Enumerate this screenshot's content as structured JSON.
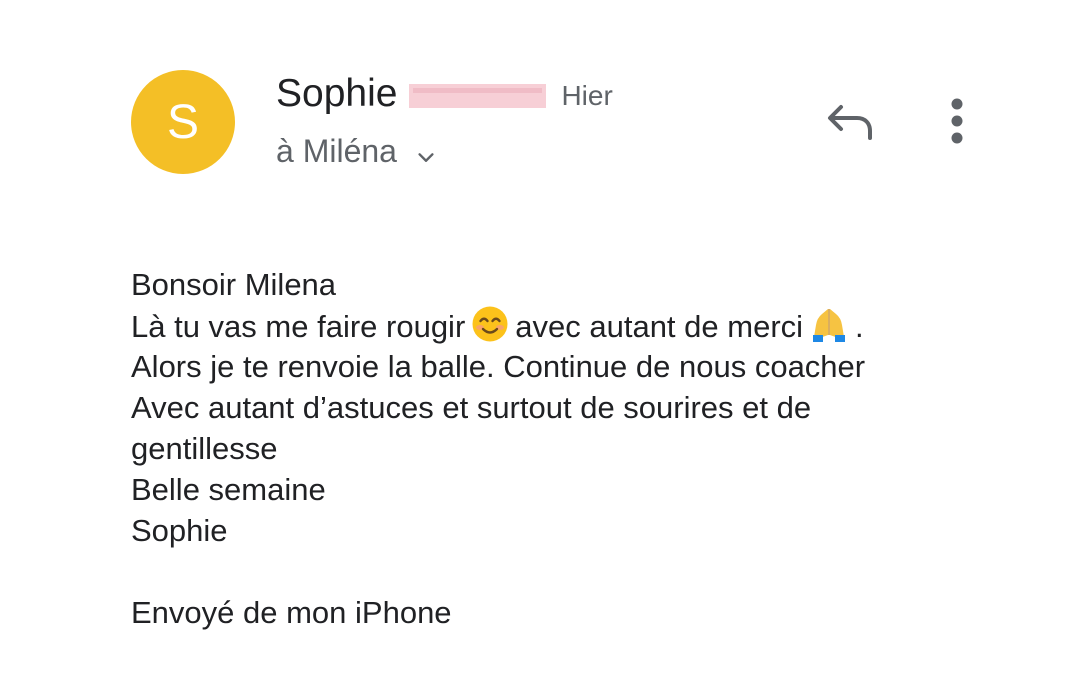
{
  "colors": {
    "avatar_bg": "#f4bf26",
    "icon_gray": "#5f6368",
    "redaction": "#f7cfd6"
  },
  "header": {
    "avatar_letter": "S",
    "sender_name": "Sophie",
    "date": "Hier",
    "recipient": "à Miléna",
    "expand_icon": "chevron-down-icon",
    "reply_icon": "reply-icon",
    "more_icon": "more-vert-icon"
  },
  "message": {
    "line1": "Bonsoir Milena",
    "line2_a": "Là tu vas me faire rougir",
    "line2_b": "avec autant de merci",
    "line2_c": ".",
    "line3": "Alors je te renvoie la balle. Continue de nous coacher",
    "line4": "Avec autant d’astuces et surtout de sourires et de",
    "line5": "gentillesse",
    "line6": "Belle semaine",
    "line7": "Sophie",
    "signature": "Envoyé de mon iPhone",
    "emoji1": "smiling-face-icon",
    "emoji2": "folded-hands-icon"
  }
}
